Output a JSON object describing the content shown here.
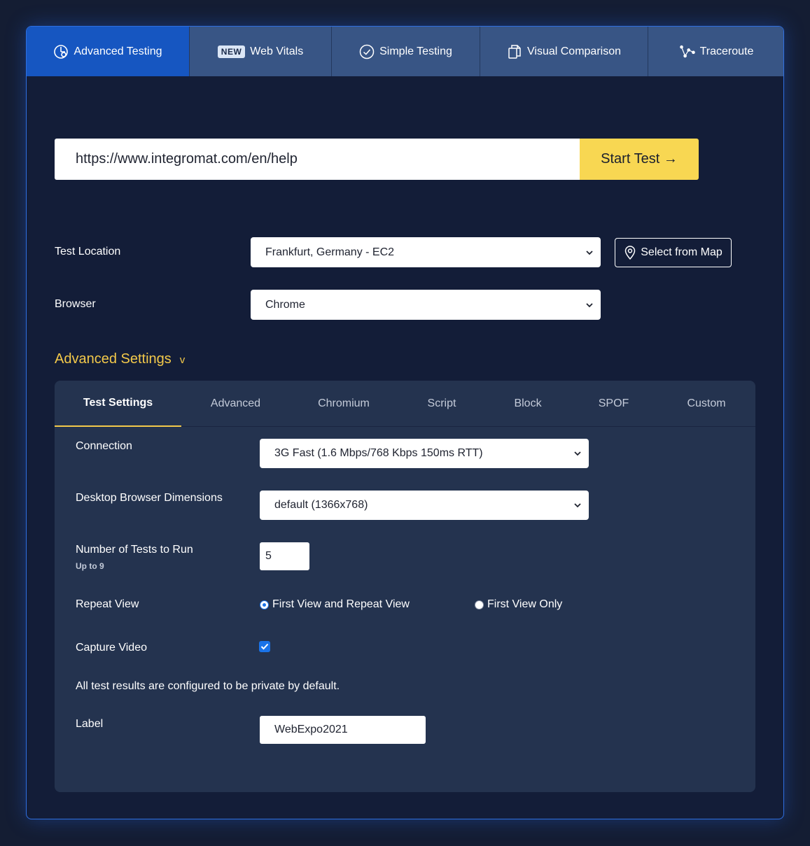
{
  "tabs": [
    {
      "label": "Advanced Testing",
      "icon": "gauge-icon",
      "active": true
    },
    {
      "label": "Web Vitals",
      "badge": "NEW",
      "active": false
    },
    {
      "label": "Simple Testing",
      "icon": "check-circle-icon",
      "active": false
    },
    {
      "label": "Visual Comparison",
      "icon": "copy-documents-icon",
      "active": false
    },
    {
      "label": "Traceroute",
      "icon": "route-icon",
      "active": false
    }
  ],
  "url_form": {
    "value": "https://www.integromat.com/en/help",
    "start_label": "Start Test →"
  },
  "location": {
    "label": "Test Location",
    "selected": "Frankfurt, Germany - EC2",
    "map_button": "Select from Map"
  },
  "browser": {
    "label": "Browser",
    "selected": "Chrome"
  },
  "advanced_toggle": {
    "label": "Advanced Settings",
    "chevron": "v"
  },
  "settings_tabs": [
    "Test Settings",
    "Advanced",
    "Chromium",
    "Script",
    "Block",
    "SPOF",
    "Custom"
  ],
  "test_settings": {
    "connection": {
      "label": "Connection",
      "selected": "3G Fast (1.6 Mbps/768 Kbps 150ms RTT)"
    },
    "dimensions": {
      "label": "Desktop Browser Dimensions",
      "selected": "default (1366x768)"
    },
    "num_tests": {
      "label": "Number of Tests to Run",
      "sublabel": "Up to 9",
      "value": "5"
    },
    "repeat_view": {
      "label": "Repeat View",
      "options": [
        "First View and Repeat View",
        "First View Only"
      ],
      "selected": "First View and Repeat View"
    },
    "capture_video": {
      "label": "Capture Video",
      "checked": true
    },
    "privacy_note": "All test results are configured to be private by default.",
    "label_field": {
      "label": "Label",
      "value": "WebExpo2021"
    }
  },
  "colors": {
    "active_tab": "#1656c1",
    "tab": "#385585",
    "start_button": "#f8d752",
    "accent_yellow": "#f3c94a",
    "panel": "#131d38",
    "settings_panel": "#24334f"
  }
}
